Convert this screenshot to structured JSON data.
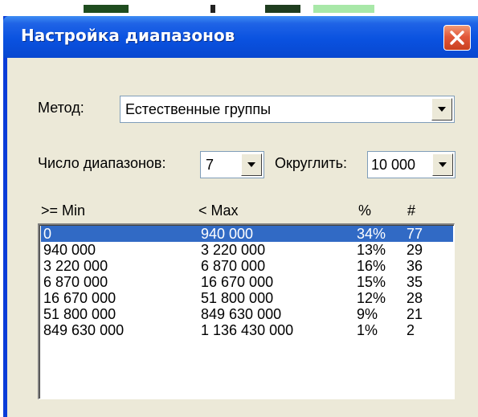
{
  "dialog": {
    "title": "Настройка диапазонов"
  },
  "method": {
    "label": "Метод:",
    "value": "Естественные группы"
  },
  "ranges": {
    "count_label": "Число диапазонов:",
    "count_value": "7",
    "round_label": "Округлить:",
    "round_value": "10 000"
  },
  "table": {
    "headers": [
      ">= Min",
      "< Max",
      "%",
      "#"
    ],
    "rows": [
      {
        "min": "0",
        "max": "940 000",
        "pct": "34%",
        "count": "77",
        "selected": true
      },
      {
        "min": "940 000",
        "max": "3 220 000",
        "pct": "13%",
        "count": "29",
        "selected": false
      },
      {
        "min": "3 220 000",
        "max": "6 870 000",
        "pct": "16%",
        "count": "36",
        "selected": false
      },
      {
        "min": "6 870 000",
        "max": "16 670 000",
        "pct": "15%",
        "count": "35",
        "selected": false
      },
      {
        "min": "16 670 000",
        "max": "51 800 000",
        "pct": "12%",
        "count": "28",
        "selected": false
      },
      {
        "min": "51 800 000",
        "max": "849 630 000",
        "pct": "9%",
        "count": "21",
        "selected": false
      },
      {
        "min": "849 630 000",
        "max": "1 136 430 000",
        "pct": "1%",
        "count": "2",
        "selected": false
      }
    ]
  },
  "colors": {
    "title_bar": "#0a52e0",
    "dialog_background": "#ece9d8",
    "selection": "#316ac5",
    "close_button": "#e2583a"
  }
}
